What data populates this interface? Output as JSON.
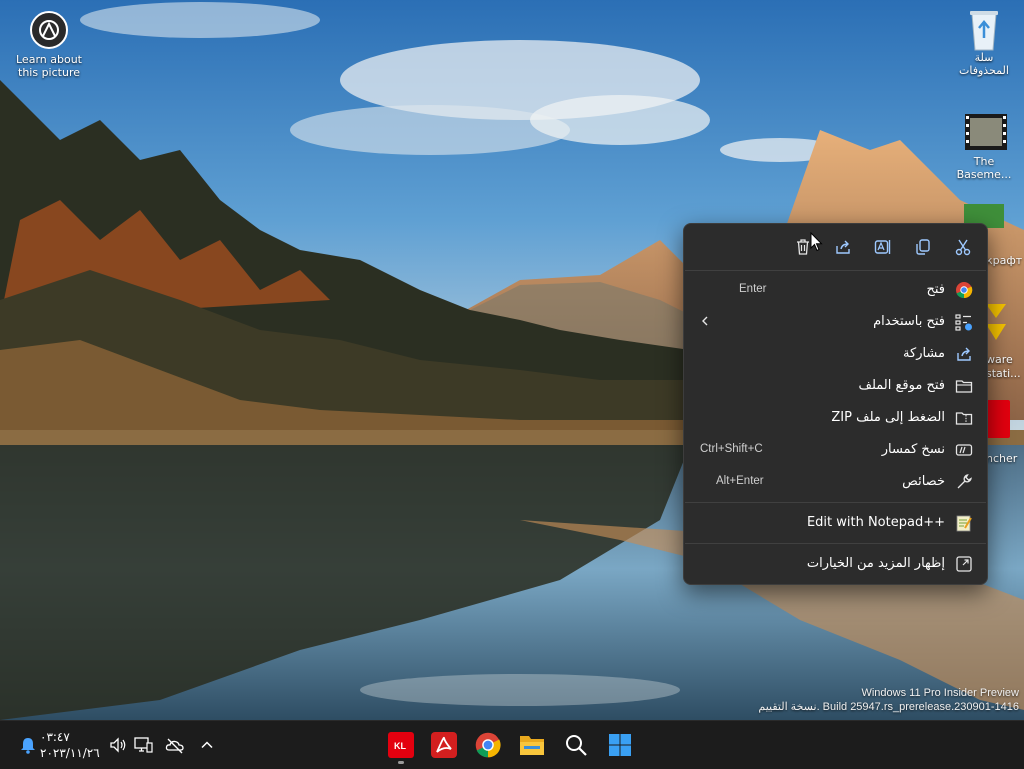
{
  "desktop": {
    "icons": [
      {
        "id": "learn",
        "label_1": "Learn about",
        "label_2": "this picture"
      },
      {
        "id": "recycle",
        "label_1": "سلة",
        "label_2": "المحذوفات"
      },
      {
        "id": "basement",
        "label_1": "The",
        "label_2": "Baseme..."
      },
      {
        "id": "minecraft",
        "label_1": "крафт"
      },
      {
        "id": "vmware",
        "label_1": "ware",
        "label_2": "stati..."
      },
      {
        "id": "launcher",
        "label_1": "ncher"
      }
    ]
  },
  "watermark": {
    "line1": "Windows 11 Pro Insider Preview",
    "line2": "نسخة التقييم. Build 25947.rs_prerelease.230901-1416"
  },
  "context_menu": {
    "toolbar": [
      {
        "id": "cut",
        "icon": "scissors-icon"
      },
      {
        "id": "copy",
        "icon": "copy-icon"
      },
      {
        "id": "rename",
        "icon": "rename-icon"
      },
      {
        "id": "share",
        "icon": "share-icon"
      },
      {
        "id": "delete",
        "icon": "trash-icon"
      }
    ],
    "items": [
      {
        "id": "open",
        "label": "فتح",
        "shortcut": "Enter",
        "icon": "chrome-icon"
      },
      {
        "id": "open-with",
        "label": "فتح باستخدام",
        "shortcut": "",
        "icon": "open-with-icon",
        "submenu": true
      },
      {
        "id": "share",
        "label": "مشاركة",
        "shortcut": "",
        "icon": "share-icon"
      },
      {
        "id": "open-location",
        "label": "فتح موقع الملف",
        "shortcut": "",
        "icon": "folder-icon"
      },
      {
        "id": "zip",
        "label": "الضغط إلى ملف ZIP",
        "shortcut": "",
        "icon": "zip-icon"
      },
      {
        "id": "copy-path",
        "label": "نسخ كمسار",
        "shortcut": "Ctrl+Shift+C",
        "icon": "copy-path-icon"
      },
      {
        "id": "properties",
        "label": "خصائص",
        "shortcut": "Alt+Enter",
        "icon": "wrench-icon"
      },
      {
        "id": "notepad",
        "label": "Edit with Notepad++",
        "shortcut": "",
        "icon": "notepad-icon"
      },
      {
        "id": "more",
        "label": "إظهار المزيد من الخيارات",
        "shortcut": "",
        "icon": "more-options-icon"
      }
    ]
  },
  "taskbar": {
    "clock_time": "٠٣:٤٧",
    "clock_date": "٢٠٢٣/١١/٢٦",
    "apps": [
      {
        "id": "kl",
        "icon": "kl-icon"
      },
      {
        "id": "acrobat",
        "icon": "acrobat-icon"
      },
      {
        "id": "chrome",
        "icon": "chrome-icon"
      },
      {
        "id": "explorer",
        "icon": "file-explorer-icon"
      },
      {
        "id": "search",
        "icon": "search-icon"
      },
      {
        "id": "start",
        "icon": "windows-start-icon"
      }
    ]
  },
  "colors": {
    "menu_bg": "#2c2c2c",
    "taskbar_bg": "#1c1c1c",
    "accent_blue": "#4aa3ff"
  }
}
